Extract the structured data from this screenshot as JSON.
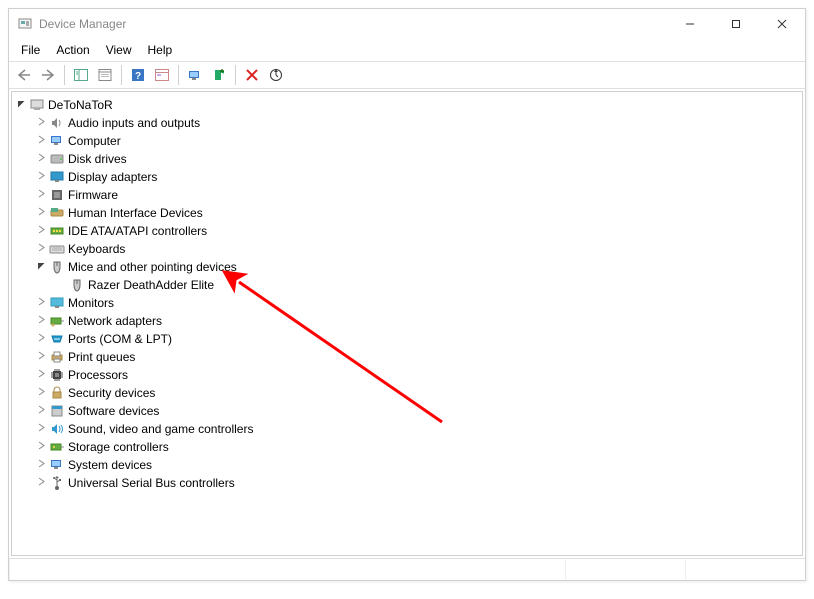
{
  "window": {
    "title": "Device Manager"
  },
  "menu": {
    "file": "File",
    "action": "Action",
    "view": "View",
    "help": "Help"
  },
  "tree": {
    "root": {
      "label": "DeToNaToR"
    },
    "nodes": {
      "audio": {
        "label": "Audio inputs and outputs"
      },
      "computer": {
        "label": "Computer"
      },
      "disk": {
        "label": "Disk drives"
      },
      "display": {
        "label": "Display adapters"
      },
      "firmware": {
        "label": "Firmware"
      },
      "hid": {
        "label": "Human Interface Devices"
      },
      "ide": {
        "label": "IDE ATA/ATAPI controllers"
      },
      "keyboards": {
        "label": "Keyboards"
      },
      "mice": {
        "label": "Mice and other pointing devices"
      },
      "mice_child": {
        "label": "Razer DeathAdder Elite"
      },
      "monitors": {
        "label": "Monitors"
      },
      "network": {
        "label": "Network adapters"
      },
      "ports": {
        "label": "Ports (COM & LPT)"
      },
      "printq": {
        "label": "Print queues"
      },
      "processors": {
        "label": "Processors"
      },
      "security": {
        "label": "Security devices"
      },
      "software": {
        "label": "Software devices"
      },
      "sound": {
        "label": "Sound, video and game controllers"
      },
      "storage": {
        "label": "Storage controllers"
      },
      "system": {
        "label": "System devices"
      },
      "usb": {
        "label": "Universal Serial Bus controllers"
      }
    }
  }
}
